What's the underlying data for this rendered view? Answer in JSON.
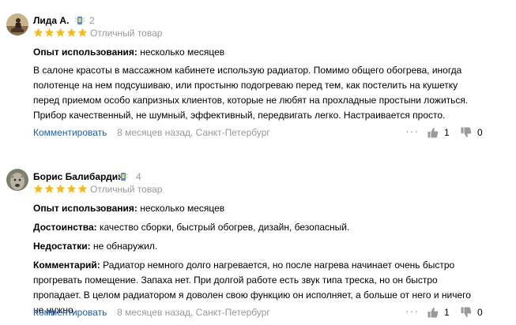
{
  "reviews": [
    {
      "author": "Лида А.",
      "badge_count": "2",
      "rating": 5,
      "rating_label": "Отличный товар",
      "experience_label": "Опыт использования:",
      "experience_value": "несколько месяцев",
      "text": "В салоне красоты в массажном кабинете использую радиатор. Помимо общего обогрева, иногда полотенце на нем подсушиваю, или простыню подогреваю перед тем, как постелить на кушетку перед приемом особо капризных клиентов, которые не любят на прохладные простыни ложиться. Прибор качественный, не шумный, эффективный, передвигать легко. Настраивается просто.",
      "comment_link": "Комментировать",
      "date_location": "8 месяцев назад, Санкт-Петербург",
      "likes": "1",
      "dislikes": "0"
    },
    {
      "author": "Борис Балибардин",
      "badge_count": "4",
      "rating": 5,
      "rating_label": "Отличный товар",
      "experience_label": "Опыт использования:",
      "experience_value": "несколько месяцев",
      "pros_label": "Достоинства:",
      "pros_value": "качество сборки, быстрый обогрев, дизайн, безопасный.",
      "cons_label": "Недостатки:",
      "cons_value": "не обнаружил.",
      "comment_label": "Комментарий:",
      "comment_value": "Радиатор немного долго нагревается, но после нагрева начинает очень быстро прогревать помещение. Запаха нет. При долгой работе есть звук типа треска, но он быстро пропадает. В целом радиатором я доволен свою функцию он исполняет, а больше от него и ничего не нужно.",
      "comment_link": "Комментировать",
      "date_location": "8 месяцев назад, Санкт-Петербург",
      "likes": "1",
      "dislikes": "0"
    }
  ],
  "icons": {
    "star": "star-icon",
    "badge": "medal-badge-icon",
    "like": "thumbs-up-icon",
    "dislike": "thumbs-down-icon",
    "more": "more-dots-icon"
  },
  "colors": {
    "star": "#fcb80f",
    "link": "#1a5dbd",
    "muted": "#999999"
  }
}
